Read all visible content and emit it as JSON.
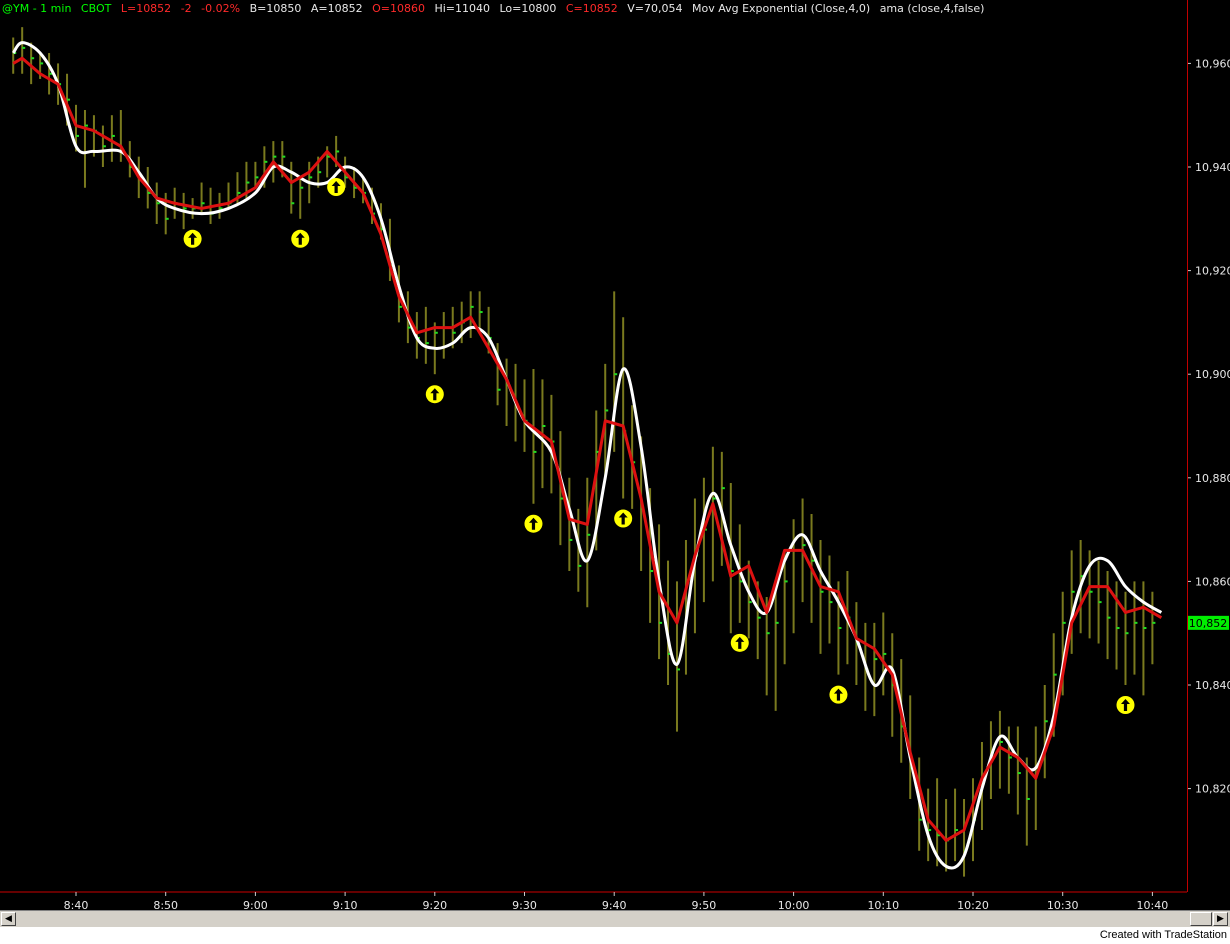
{
  "status": {
    "symbol": "@YM - 1 min",
    "exchange": "CBOT",
    "last": "L=10852",
    "net_change": "-2",
    "pct_change": "-0.02%",
    "bid": "B=10850",
    "ask": "A=10852",
    "open": "O=10860",
    "high": "Hi=11040",
    "low": "Lo=10800",
    "close": "C=10852",
    "volume": "V=70,054",
    "indicator_1": "Mov Avg Exponential (Close,4,0)",
    "indicator_2": "ama (close,4,false)"
  },
  "colors": {
    "background": "#000000",
    "bars": "#7a7a1e",
    "close_tick": "#22dd22",
    "ema_line": "#dd1111",
    "ama_line": "#ffffff",
    "axis_frame": "#cc0000",
    "signal_marker": "#ffff00",
    "last_price_tag": "#00ee00"
  },
  "chart_data": {
    "type": "line",
    "x_type": "time",
    "interval": "1 min",
    "ylim": [
      10803,
      10968
    ],
    "y_ticks": [
      10820,
      10840,
      10860,
      10880,
      10900,
      10920,
      10940,
      10960
    ],
    "y_tick_labels": [
      "10,820",
      "10,840",
      "10,860",
      "10,880",
      "10,900",
      "10,920",
      "10,940",
      "10,960"
    ],
    "x_ticks": [
      "8:40",
      "8:50",
      "9:00",
      "9:10",
      "9:20",
      "9:30",
      "9:40",
      "9:50",
      "10:00",
      "10:10",
      "10:20",
      "10:30",
      "10:40"
    ],
    "last_price_label": "10,852",
    "last_price": 10852,
    "series": [
      {
        "name": "ama (close,4,false)",
        "x": [
          "8:33",
          "8:34",
          "8:36",
          "8:38",
          "8:40",
          "8:42",
          "8:45",
          "8:47",
          "8:49",
          "8:51",
          "8:54",
          "8:57",
          "9:00",
          "9:02",
          "9:04",
          "9:06",
          "9:08",
          "9:10",
          "9:12",
          "9:14",
          "9:16",
          "9:18",
          "9:20",
          "9:22",
          "9:24",
          "9:26",
          "9:28",
          "9:30",
          "9:33",
          "9:35",
          "9:37",
          "9:39",
          "9:41",
          "9:43",
          "9:45",
          "9:47",
          "9:49",
          "9:51",
          "9:53",
          "9:55",
          "9:57",
          "9:59",
          "10:01",
          "10:03",
          "10:05",
          "10:07",
          "10:09",
          "10:11",
          "10:13",
          "10:15",
          "10:17",
          "10:19",
          "10:21",
          "10:23",
          "10:25",
          "10:27",
          "10:29",
          "10:31",
          "10:33",
          "10:35",
          "10:37",
          "10:39",
          "10:41"
        ],
        "values": [
          10962,
          10964,
          10962,
          10956,
          10944,
          10943,
          10943,
          10939,
          10934,
          10932,
          10931,
          10932,
          10935,
          10940,
          10939,
          10937,
          10937,
          10940,
          10938,
          10930,
          10917,
          10907,
          10905,
          10906,
          10909,
          10907,
          10899,
          10891,
          10885,
          10874,
          10864,
          10880,
          10901,
          10886,
          10860,
          10844,
          10864,
          10877,
          10867,
          10858,
          10854,
          10864,
          10869,
          10862,
          10856,
          10849,
          10840,
          10843,
          10826,
          10811,
          10805,
          10807,
          10820,
          10830,
          10826,
          10824,
          10834,
          10853,
          10863,
          10864,
          10859,
          10856,
          10854
        ]
      },
      {
        "name": "Mov Avg Exponential (Close,4,0)",
        "x": [
          "8:33",
          "8:34",
          "8:36",
          "8:38",
          "8:40",
          "8:42",
          "8:45",
          "8:47",
          "8:49",
          "8:51",
          "8:54",
          "8:57",
          "9:00",
          "9:02",
          "9:04",
          "9:06",
          "9:08",
          "9:10",
          "9:12",
          "9:14",
          "9:16",
          "9:18",
          "9:20",
          "9:22",
          "9:24",
          "9:26",
          "9:28",
          "9:30",
          "9:33",
          "9:35",
          "9:37",
          "9:39",
          "9:41",
          "9:43",
          "9:45",
          "9:47",
          "9:49",
          "9:51",
          "9:53",
          "9:55",
          "9:57",
          "9:59",
          "10:01",
          "10:03",
          "10:05",
          "10:07",
          "10:09",
          "10:11",
          "10:13",
          "10:15",
          "10:17",
          "10:19",
          "10:21",
          "10:23",
          "10:25",
          "10:27",
          "10:29",
          "10:31",
          "10:33",
          "10:35",
          "10:37",
          "10:39",
          "10:41"
        ],
        "values": [
          10960,
          10961,
          10958,
          10956,
          10948,
          10947,
          10944,
          10938,
          10934,
          10933,
          10932,
          10933,
          10936,
          10941,
          10937,
          10939,
          10943,
          10939,
          10935,
          10927,
          10915,
          10908,
          10909,
          10909,
          10911,
          10905,
          10899,
          10891,
          10887,
          10872,
          10871,
          10891,
          10890,
          10876,
          10858,
          10852,
          10865,
          10875,
          10861,
          10863,
          10854,
          10866,
          10866,
          10859,
          10858,
          10849,
          10847,
          10842,
          10827,
          10814,
          10810,
          10812,
          10822,
          10828,
          10826,
          10822,
          10832,
          10852,
          10859,
          10859,
          10854,
          10855,
          10853
        ]
      }
    ],
    "bars": [
      {
        "x": "8:33",
        "low": 10958,
        "high": 10965,
        "close": 10962
      },
      {
        "x": "8:34",
        "low": 10958,
        "high": 10967,
        "close": 10963
      },
      {
        "x": "8:35",
        "low": 10956,
        "high": 10964,
        "close": 10961
      },
      {
        "x": "8:36",
        "low": 10957,
        "high": 10962,
        "close": 10960
      },
      {
        "x": "8:37",
        "low": 10954,
        "high": 10962,
        "close": 10958
      },
      {
        "x": "8:38",
        "low": 10952,
        "high": 10960,
        "close": 10956
      },
      {
        "x": "8:39",
        "low": 10948,
        "high": 10958,
        "close": 10953
      },
      {
        "x": "8:40",
        "low": 10943,
        "high": 10952,
        "close": 10946
      },
      {
        "x": "8:41",
        "low": 10936,
        "high": 10951,
        "close": 10948
      },
      {
        "x": "8:42",
        "low": 10942,
        "high": 10950,
        "close": 10947
      },
      {
        "x": "8:43",
        "low": 10940,
        "high": 10948,
        "close": 10944
      },
      {
        "x": "8:44",
        "low": 10941,
        "high": 10950,
        "close": 10946
      },
      {
        "x": "8:45",
        "low": 10941,
        "high": 10951,
        "close": 10943
      },
      {
        "x": "8:46",
        "low": 10938,
        "high": 10945,
        "close": 10940
      },
      {
        "x": "8:47",
        "low": 10934,
        "high": 10942,
        "close": 10938
      },
      {
        "x": "8:48",
        "low": 10932,
        "high": 10940,
        "close": 10935
      },
      {
        "x": "8:49",
        "low": 10929,
        "high": 10937,
        "close": 10933
      },
      {
        "x": "8:50",
        "low": 10927,
        "high": 10935,
        "close": 10930
      },
      {
        "x": "8:51",
        "low": 10930,
        "high": 10936,
        "close": 10933
      },
      {
        "x": "8:52",
        "low": 10928,
        "high": 10935,
        "close": 10932
      },
      {
        "x": "8:53",
        "low": 10930,
        "high": 10934,
        "close": 10932
      },
      {
        "x": "8:54",
        "low": 10931,
        "high": 10937,
        "close": 10933
      },
      {
        "x": "8:55",
        "low": 10929,
        "high": 10936,
        "close": 10931
      },
      {
        "x": "8:56",
        "low": 10930,
        "high": 10935,
        "close": 10932
      },
      {
        "x": "8:57",
        "low": 10932,
        "high": 10937,
        "close": 10933
      },
      {
        "x": "8:58",
        "low": 10933,
        "high": 10939,
        "close": 10935
      },
      {
        "x": "8:59",
        "low": 10934,
        "high": 10941,
        "close": 10937
      },
      {
        "x": "9:00",
        "low": 10936,
        "high": 10941,
        "close": 10938
      },
      {
        "x": "9:01",
        "low": 10936,
        "high": 10944,
        "close": 10941
      },
      {
        "x": "9:02",
        "low": 10937,
        "high": 10945,
        "close": 10942
      },
      {
        "x": "9:03",
        "low": 10938,
        "high": 10945,
        "close": 10942
      },
      {
        "x": "9:04",
        "low": 10931,
        "high": 10941,
        "close": 10933
      },
      {
        "x": "9:05",
        "low": 10930,
        "high": 10938,
        "close": 10936
      },
      {
        "x": "9:06",
        "low": 10933,
        "high": 10941,
        "close": 10938
      },
      {
        "x": "9:07",
        "low": 10936,
        "high": 10942,
        "close": 10939
      },
      {
        "x": "9:08",
        "low": 10938,
        "high": 10944,
        "close": 10942
      },
      {
        "x": "9:09",
        "low": 10940,
        "high": 10946,
        "close": 10943
      },
      {
        "x": "9:10",
        "low": 10936,
        "high": 10942,
        "close": 10938
      },
      {
        "x": "9:11",
        "low": 10934,
        "high": 10940,
        "close": 10936
      },
      {
        "x": "9:12",
        "low": 10933,
        "high": 10938,
        "close": 10935
      },
      {
        "x": "9:13",
        "low": 10929,
        "high": 10936,
        "close": 10931
      },
      {
        "x": "9:14",
        "low": 10926,
        "high": 10933,
        "close": 10928
      },
      {
        "x": "9:15",
        "low": 10918,
        "high": 10930,
        "close": 10921
      },
      {
        "x": "9:16",
        "low": 10910,
        "high": 10921,
        "close": 10913
      },
      {
        "x": "9:17",
        "low": 10906,
        "high": 10916,
        "close": 10909
      },
      {
        "x": "9:18",
        "low": 10903,
        "high": 10912,
        "close": 10907
      },
      {
        "x": "9:19",
        "low": 10902,
        "high": 10913,
        "close": 10906
      },
      {
        "x": "9:20",
        "low": 10900,
        "high": 10910,
        "close": 10908
      },
      {
        "x": "9:21",
        "low": 10903,
        "high": 10912,
        "close": 10909
      },
      {
        "x": "9:22",
        "low": 10905,
        "high": 10913,
        "close": 10908
      },
      {
        "x": "9:23",
        "low": 10906,
        "high": 10914,
        "close": 10910
      },
      {
        "x": "9:24",
        "low": 10907,
        "high": 10916,
        "close": 10913
      },
      {
        "x": "9:25",
        "low": 10908,
        "high": 10916,
        "close": 10912
      },
      {
        "x": "9:26",
        "low": 10904,
        "high": 10913,
        "close": 10907
      },
      {
        "x": "9:27",
        "low": 10894,
        "high": 10906,
        "close": 10897
      },
      {
        "x": "9:28",
        "low": 10890,
        "high": 10903,
        "close": 10898
      },
      {
        "x": "9:29",
        "low": 10887,
        "high": 10902,
        "close": 10894
      },
      {
        "x": "9:30",
        "low": 10885,
        "high": 10899,
        "close": 10891
      },
      {
        "x": "9:31",
        "low": 10875,
        "high": 10901,
        "close": 10885
      },
      {
        "x": "9:32",
        "low": 10878,
        "high": 10899,
        "close": 10890
      },
      {
        "x": "9:33",
        "low": 10877,
        "high": 10896,
        "close": 10887
      },
      {
        "x": "9:34",
        "low": 10867,
        "high": 10889,
        "close": 10876
      },
      {
        "x": "9:35",
        "low": 10862,
        "high": 10880,
        "close": 10868
      },
      {
        "x": "9:36",
        "low": 10858,
        "high": 10874,
        "close": 10863
      },
      {
        "x": "9:37",
        "low": 10855,
        "high": 10880,
        "close": 10869
      },
      {
        "x": "9:38",
        "low": 10866,
        "high": 10893,
        "close": 10885
      },
      {
        "x": "9:39",
        "low": 10880,
        "high": 10902,
        "close": 10893
      },
      {
        "x": "9:40",
        "low": 10885,
        "high": 10916,
        "close": 10900
      },
      {
        "x": "9:41",
        "low": 10876,
        "high": 10911,
        "close": 10889
      },
      {
        "x": "9:42",
        "low": 10874,
        "high": 10894,
        "close": 10883
      },
      {
        "x": "9:43",
        "low": 10862,
        "high": 10888,
        "close": 10874
      },
      {
        "x": "9:44",
        "low": 10852,
        "high": 10878,
        "close": 10862
      },
      {
        "x": "9:45",
        "low": 10845,
        "high": 10871,
        "close": 10852
      },
      {
        "x": "9:46",
        "low": 10840,
        "high": 10864,
        "close": 10846
      },
      {
        "x": "9:47",
        "low": 10831,
        "high": 10860,
        "close": 10843
      },
      {
        "x": "9:48",
        "low": 10842,
        "high": 10868,
        "close": 10855
      },
      {
        "x": "9:49",
        "low": 10850,
        "high": 10876,
        "close": 10865
      },
      {
        "x": "9:50",
        "low": 10856,
        "high": 10880,
        "close": 10870
      },
      {
        "x": "9:51",
        "low": 10860,
        "high": 10886,
        "close": 10876
      },
      {
        "x": "9:52",
        "low": 10863,
        "high": 10885,
        "close": 10878
      },
      {
        "x": "9:53",
        "low": 10850,
        "high": 10879,
        "close": 10862
      },
      {
        "x": "9:54",
        "low": 10852,
        "high": 10871,
        "close": 10860
      },
      {
        "x": "9:55",
        "low": 10849,
        "high": 10864,
        "close": 10856
      },
      {
        "x": "9:56",
        "low": 10845,
        "high": 10860,
        "close": 10853
      },
      {
        "x": "9:57",
        "low": 10838,
        "high": 10857,
        "close": 10850
      },
      {
        "x": "9:58",
        "low": 10835,
        "high": 10860,
        "close": 10852
      },
      {
        "x": "9:59",
        "low": 10844,
        "high": 10866,
        "close": 10860
      },
      {
        "x": "10:00",
        "low": 10850,
        "high": 10872,
        "close": 10866
      },
      {
        "x": "10:01",
        "low": 10856,
        "high": 10876,
        "close": 10867
      },
      {
        "x": "10:02",
        "low": 10852,
        "high": 10873,
        "close": 10864
      },
      {
        "x": "10:03",
        "low": 10846,
        "high": 10868,
        "close": 10858
      },
      {
        "x": "10:04",
        "low": 10848,
        "high": 10865,
        "close": 10856
      },
      {
        "x": "10:05",
        "low": 10842,
        "high": 10860,
        "close": 10851
      },
      {
        "x": "10:06",
        "low": 10844,
        "high": 10862,
        "close": 10853
      },
      {
        "x": "10:07",
        "low": 10840,
        "high": 10856,
        "close": 10848
      },
      {
        "x": "10:08",
        "low": 10835,
        "high": 10852,
        "close": 10843
      },
      {
        "x": "10:09",
        "low": 10834,
        "high": 10852,
        "close": 10845
      },
      {
        "x": "10:10",
        "low": 10838,
        "high": 10854,
        "close": 10846
      },
      {
        "x": "10:11",
        "low": 10830,
        "high": 10850,
        "close": 10840
      },
      {
        "x": "10:12",
        "low": 10825,
        "high": 10845,
        "close": 10832
      },
      {
        "x": "10:13",
        "low": 10818,
        "high": 10838,
        "close": 10824
      },
      {
        "x": "10:14",
        "low": 10808,
        "high": 10826,
        "close": 10814
      },
      {
        "x": "10:15",
        "low": 10806,
        "high": 10820,
        "close": 10812
      },
      {
        "x": "10:16",
        "low": 10805,
        "high": 10822,
        "close": 10811
      },
      {
        "x": "10:17",
        "low": 10804,
        "high": 10818,
        "close": 10810
      },
      {
        "x": "10:18",
        "low": 10806,
        "high": 10820,
        "close": 10812
      },
      {
        "x": "10:19",
        "low": 10803,
        "high": 10818,
        "close": 10808
      },
      {
        "x": "10:20",
        "low": 10806,
        "high": 10822,
        "close": 10814
      },
      {
        "x": "10:21",
        "low": 10812,
        "high": 10829,
        "close": 10821
      },
      {
        "x": "10:22",
        "low": 10818,
        "high": 10833,
        "close": 10827
      },
      {
        "x": "10:23",
        "low": 10820,
        "high": 10835,
        "close": 10829
      },
      {
        "x": "10:24",
        "low": 10819,
        "high": 10832,
        "close": 10826
      },
      {
        "x": "10:25",
        "low": 10815,
        "high": 10832,
        "close": 10823
      },
      {
        "x": "10:26",
        "low": 10809,
        "high": 10826,
        "close": 10818
      },
      {
        "x": "10:27",
        "low": 10812,
        "high": 10832,
        "close": 10824
      },
      {
        "x": "10:28",
        "low": 10822,
        "high": 10840,
        "close": 10833
      },
      {
        "x": "10:29",
        "low": 10830,
        "high": 10850,
        "close": 10842
      },
      {
        "x": "10:30",
        "low": 10838,
        "high": 10858,
        "close": 10852
      },
      {
        "x": "10:31",
        "low": 10846,
        "high": 10866,
        "close": 10858
      },
      {
        "x": "10:32",
        "low": 10850,
        "high": 10868,
        "close": 10861
      },
      {
        "x": "10:33",
        "low": 10849,
        "high": 10866,
        "close": 10858
      },
      {
        "x": "10:34",
        "low": 10848,
        "high": 10864,
        "close": 10856
      },
      {
        "x": "10:35",
        "low": 10845,
        "high": 10862,
        "close": 10853
      },
      {
        "x": "10:36",
        "low": 10843,
        "high": 10860,
        "close": 10851
      },
      {
        "x": "10:37",
        "low": 10840,
        "high": 10858,
        "close": 10850
      },
      {
        "x": "10:38",
        "low": 10842,
        "high": 10860,
        "close": 10852
      },
      {
        "x": "10:39",
        "low": 10838,
        "high": 10860,
        "close": 10851
      },
      {
        "x": "10:40",
        "low": 10844,
        "high": 10858,
        "close": 10852
      }
    ],
    "signals": [
      "8:53",
      "9:05",
      "9:09",
      "9:20",
      "9:31",
      "9:41",
      "9:54",
      "10:05",
      "10:37"
    ]
  }
}
